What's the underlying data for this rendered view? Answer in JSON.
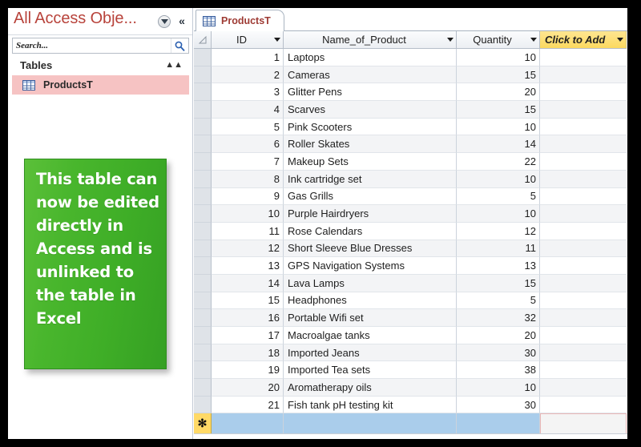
{
  "window": {
    "frame_color": "#000000",
    "background": "#ffffff"
  },
  "nav_pane": {
    "title": "All Access Obje...",
    "title_color": "#b8433b",
    "dropdown_icon": "chevron-down-circle-icon",
    "collapse_icon": "double-chevron-left-icon",
    "search": {
      "placeholder": "Search...",
      "value": "",
      "icon": "search-icon"
    },
    "groups": [
      {
        "label": "Tables",
        "collapse_icon": "double-chevron-up-icon",
        "items": [
          {
            "label": "ProductsT",
            "icon": "table-icon",
            "selected": true,
            "selected_color": "#f6c3c3"
          }
        ]
      }
    ]
  },
  "callout": {
    "text": "This table can now be edited directly in Access and is unlinked to the table in Excel",
    "background_color": "#45b52b",
    "text_color": "#ffffff"
  },
  "datasheet": {
    "tab": {
      "label": "ProductsT",
      "icon": "table-icon",
      "label_color": "#9e3b34",
      "active": true
    },
    "columns": [
      {
        "key": "select",
        "label": "",
        "arrow": false
      },
      {
        "key": "id",
        "label": "ID",
        "arrow": true
      },
      {
        "key": "name",
        "label": "Name_of_Product",
        "arrow": true
      },
      {
        "key": "qty",
        "label": "Quantity",
        "arrow": true
      },
      {
        "key": "add",
        "label": "Click to Add",
        "arrow": true,
        "highlight_color": "#fbd95f"
      }
    ],
    "rows": [
      {
        "id": "1",
        "name": "Laptops",
        "qty": "10"
      },
      {
        "id": "2",
        "name": "Cameras",
        "qty": "15"
      },
      {
        "id": "3",
        "name": "Glitter Pens",
        "qty": "20"
      },
      {
        "id": "4",
        "name": "Scarves",
        "qty": "15"
      },
      {
        "id": "5",
        "name": "Pink Scooters",
        "qty": "10"
      },
      {
        "id": "6",
        "name": "Roller Skates",
        "qty": "14"
      },
      {
        "id": "7",
        "name": "Makeup Sets",
        "qty": "22"
      },
      {
        "id": "8",
        "name": "Ink cartridge set",
        "qty": "10"
      },
      {
        "id": "9",
        "name": "Gas Grills",
        "qty": "5"
      },
      {
        "id": "10",
        "name": "Purple Hairdryers",
        "qty": "10"
      },
      {
        "id": "11",
        "name": "Rose Calendars",
        "qty": "12"
      },
      {
        "id": "12",
        "name": "Short Sleeve Blue Dresses",
        "qty": "11"
      },
      {
        "id": "13",
        "name": "GPS Navigation Systems",
        "qty": "13"
      },
      {
        "id": "14",
        "name": "Lava Lamps",
        "qty": "15"
      },
      {
        "id": "15",
        "name": "Headphones",
        "qty": "5"
      },
      {
        "id": "16",
        "name": "Portable Wifi set",
        "qty": "32"
      },
      {
        "id": "17",
        "name": "Macroalgae tanks",
        "qty": "20"
      },
      {
        "id": "18",
        "name": "Imported Jeans",
        "qty": "30"
      },
      {
        "id": "19",
        "name": "Imported Tea sets",
        "qty": "38"
      },
      {
        "id": "20",
        "name": "Aromatherapy oils",
        "qty": "10"
      },
      {
        "id": "21",
        "name": "Fish tank pH testing kit",
        "qty": "30"
      }
    ],
    "new_record_row": {
      "marker": "✻",
      "marker_color": "#ffd966",
      "row_color": "#aacdeb"
    }
  }
}
